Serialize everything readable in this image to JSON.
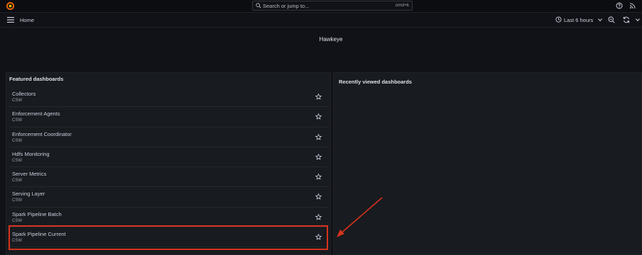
{
  "topbar": {
    "logo_icon": "grafana-logo-icon",
    "search_placeholder": "Search or jump to...",
    "search_shortcut": "cmd+k",
    "icons": [
      "help-icon",
      "rss-icon"
    ]
  },
  "subbar": {
    "breadcrumb": "Home",
    "time_range": "Last 6 hours",
    "icons": [
      "clock-icon",
      "chevron-down-icon",
      "zoom-out-icon",
      "refresh-icon"
    ]
  },
  "dashboard_title": "Hawkeye",
  "featured": {
    "title": "Featured dashboards",
    "items": [
      {
        "name": "Collectors",
        "tag": "CSW"
      },
      {
        "name": "Enforcement Agents",
        "tag": "CSW"
      },
      {
        "name": "Enforcement Coordinator",
        "tag": "CSW"
      },
      {
        "name": "Hdfs Monitoring",
        "tag": "CSW"
      },
      {
        "name": "Server Metrics",
        "tag": "CSW"
      },
      {
        "name": "Serving Layer",
        "tag": "CSW"
      },
      {
        "name": "Spark Pipeline Batch",
        "tag": "CSW"
      },
      {
        "name": "Spark Pipeline Current",
        "tag": "CSW"
      }
    ]
  },
  "recent": {
    "title": "Recently viewed dashboards"
  },
  "colors": {
    "highlight": "#d6331e",
    "background": "#111217",
    "panel": "#181b1f"
  }
}
